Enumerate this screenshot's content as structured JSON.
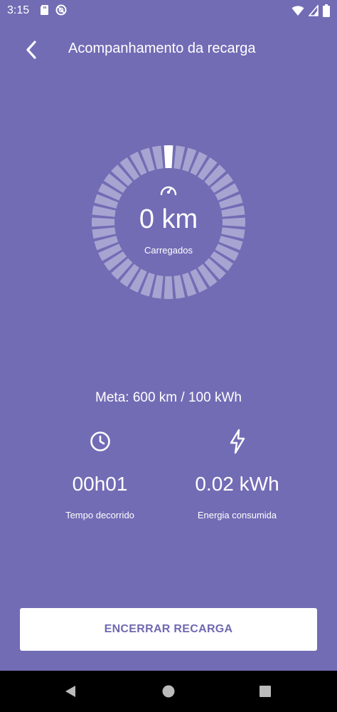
{
  "status_bar": {
    "time": "3:15",
    "icons": [
      "sd-card-icon",
      "do-not-disturb-icon",
      "wifi-icon",
      "signal-icon",
      "battery-icon"
    ]
  },
  "app_bar": {
    "title": "Acompanhamento da recarga"
  },
  "gauge": {
    "value": "0 km",
    "caption": "Carregados",
    "progress": 0,
    "icon": "speedometer-icon"
  },
  "goal": {
    "text": "Meta: 600 km / 100 kWh"
  },
  "stats": [
    {
      "icon": "clock-icon",
      "value": "00h01",
      "label": "Tempo decorrido"
    },
    {
      "icon": "lightning-icon",
      "value": "0.02 kWh",
      "label": "Energia consumida"
    }
  ],
  "end_button": {
    "label": "ENCERRAR RECARGA"
  },
  "colors": {
    "background": "#726CB5",
    "button_text": "#6F69B0"
  }
}
